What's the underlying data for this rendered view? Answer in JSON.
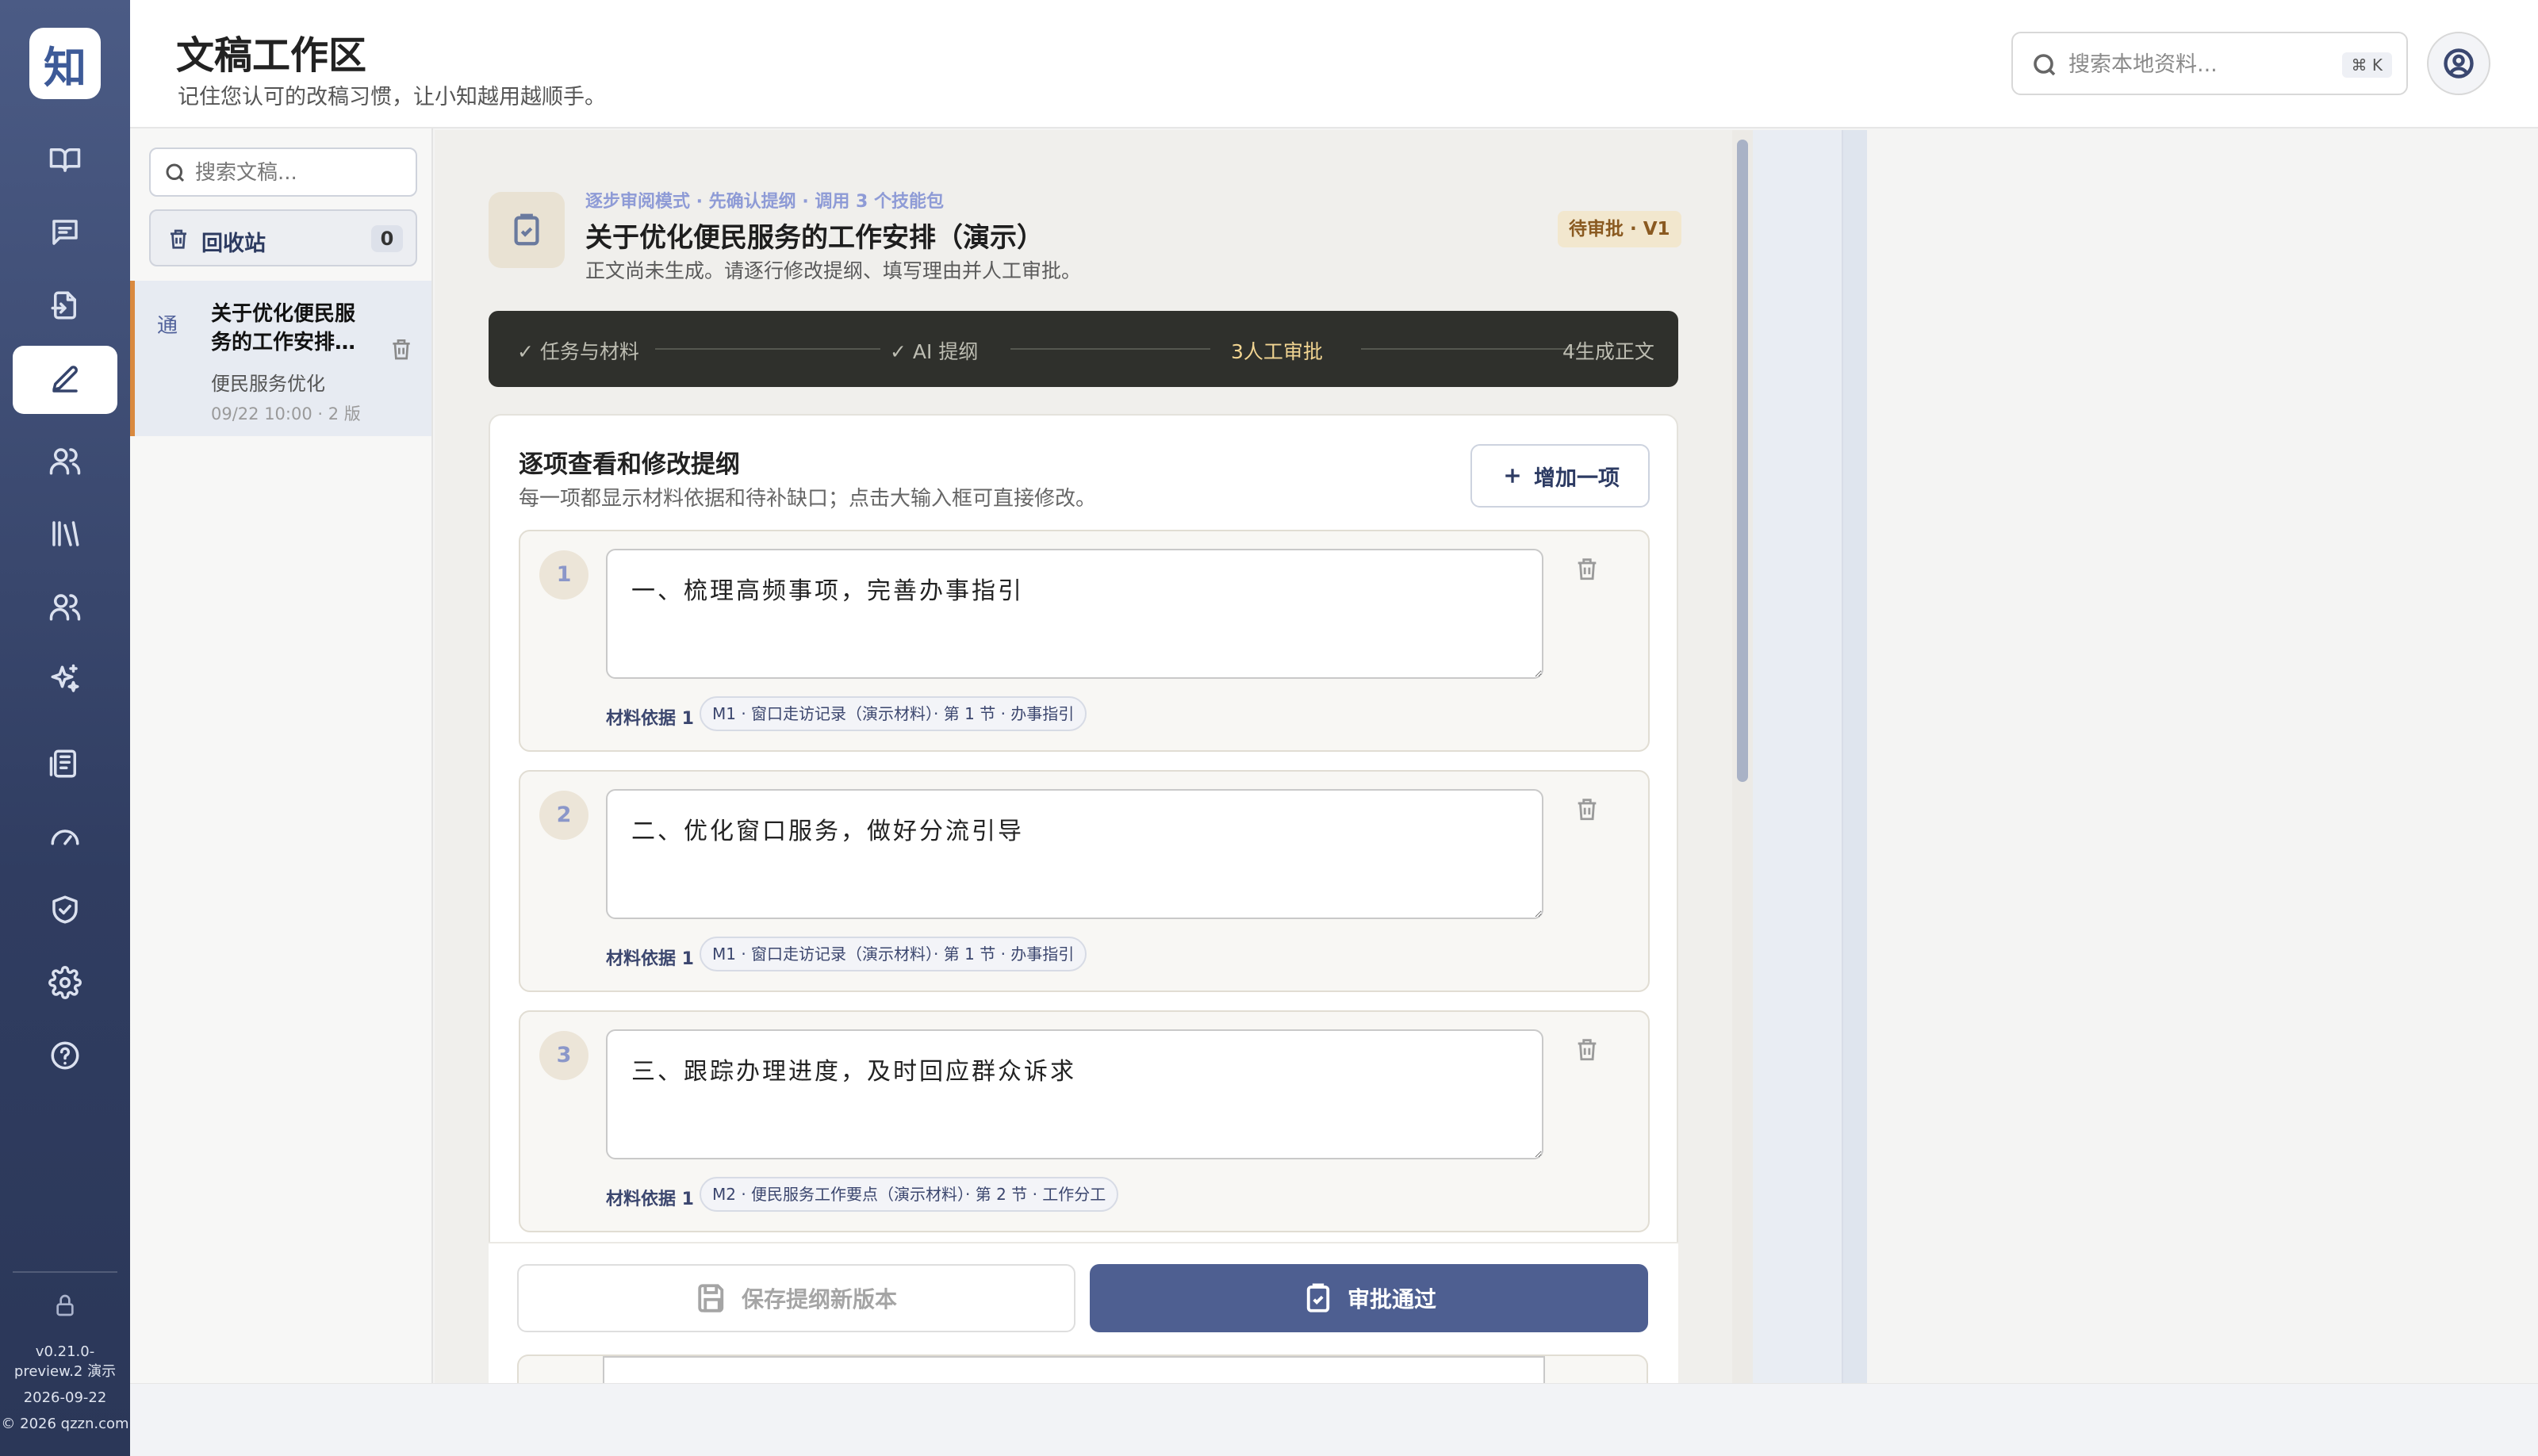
{
  "app": {
    "logo_glyph": "知",
    "version_line1": "v0.21.0-",
    "version_line2": "preview.2 演示",
    "version_date": "2026-09-22",
    "copyright": "© 2026 qzzn.com"
  },
  "header": {
    "title": "文稿工作区",
    "subtitle": "记住您认可的改稿习惯，让小知越用越顺手。",
    "search_placeholder": "搜索本地资料...",
    "search_shortcut": "⌘ K"
  },
  "doclist": {
    "search_placeholder": "搜索文稿...",
    "trash_label": "回收站",
    "trash_count": "0",
    "items": [
      {
        "mark": "通",
        "title_line1": "关于优化便民服",
        "title_line2": "务的工作安排…",
        "category": "便民服务优化",
        "meta": "09/22 10:00 · 2 版"
      }
    ]
  },
  "document": {
    "mode_line": "逐步审阅模式 · 先确认提纲 · 调用 3 个技能包",
    "title": "关于优化便民服务的工作安排（演示）",
    "subtitle": "正文尚未生成。请逐行修改提纲、填写理由并人工审批。",
    "status_badge": "待审批 · V1"
  },
  "stepper": {
    "steps": [
      {
        "label": "✓ 任务与材料"
      },
      {
        "label": "✓ AI 提纲"
      },
      {
        "label": "3人工审批"
      },
      {
        "label": "4生成正文"
      }
    ],
    "current_index": 2
  },
  "outline": {
    "title": "逐项查看和修改提纲",
    "subtitle": "每一项都显示材料依据和待补缺口；点击大输入框可直接修改。",
    "add_label": "增加一项",
    "items": [
      {
        "number": "1",
        "text": "一、梳理高频事项，完善办事指引",
        "source_label": "材料依据 1",
        "source": "M1 · 窗口走访记录（演示材料）· 第 1 节 · 办事指引"
      },
      {
        "number": "2",
        "text": "二、优化窗口服务，做好分流引导",
        "source_label": "材料依据 1",
        "source": "M1 · 窗口走访记录（演示材料）· 第 1 节 · 办事指引"
      },
      {
        "number": "3",
        "text": "三、跟踪办理进度，及时回应群众诉求",
        "source_label": "材料依据 1",
        "source": "M2 · 便民服务工作要点（演示材料）· 第 2 节 · 工作分工"
      }
    ]
  },
  "actions": {
    "save_label": "保存提纲新版本",
    "approve_label": "审批通过"
  },
  "colors": {
    "rail_top": "#4b5b85",
    "rail_bottom": "#2b3758",
    "accent": "#4e5f91",
    "stepper_bg": "#2f302c",
    "stepper_current": "#f2d592",
    "badge_bg": "#f2e7ce",
    "doc_selected_border": "#d9893f"
  }
}
